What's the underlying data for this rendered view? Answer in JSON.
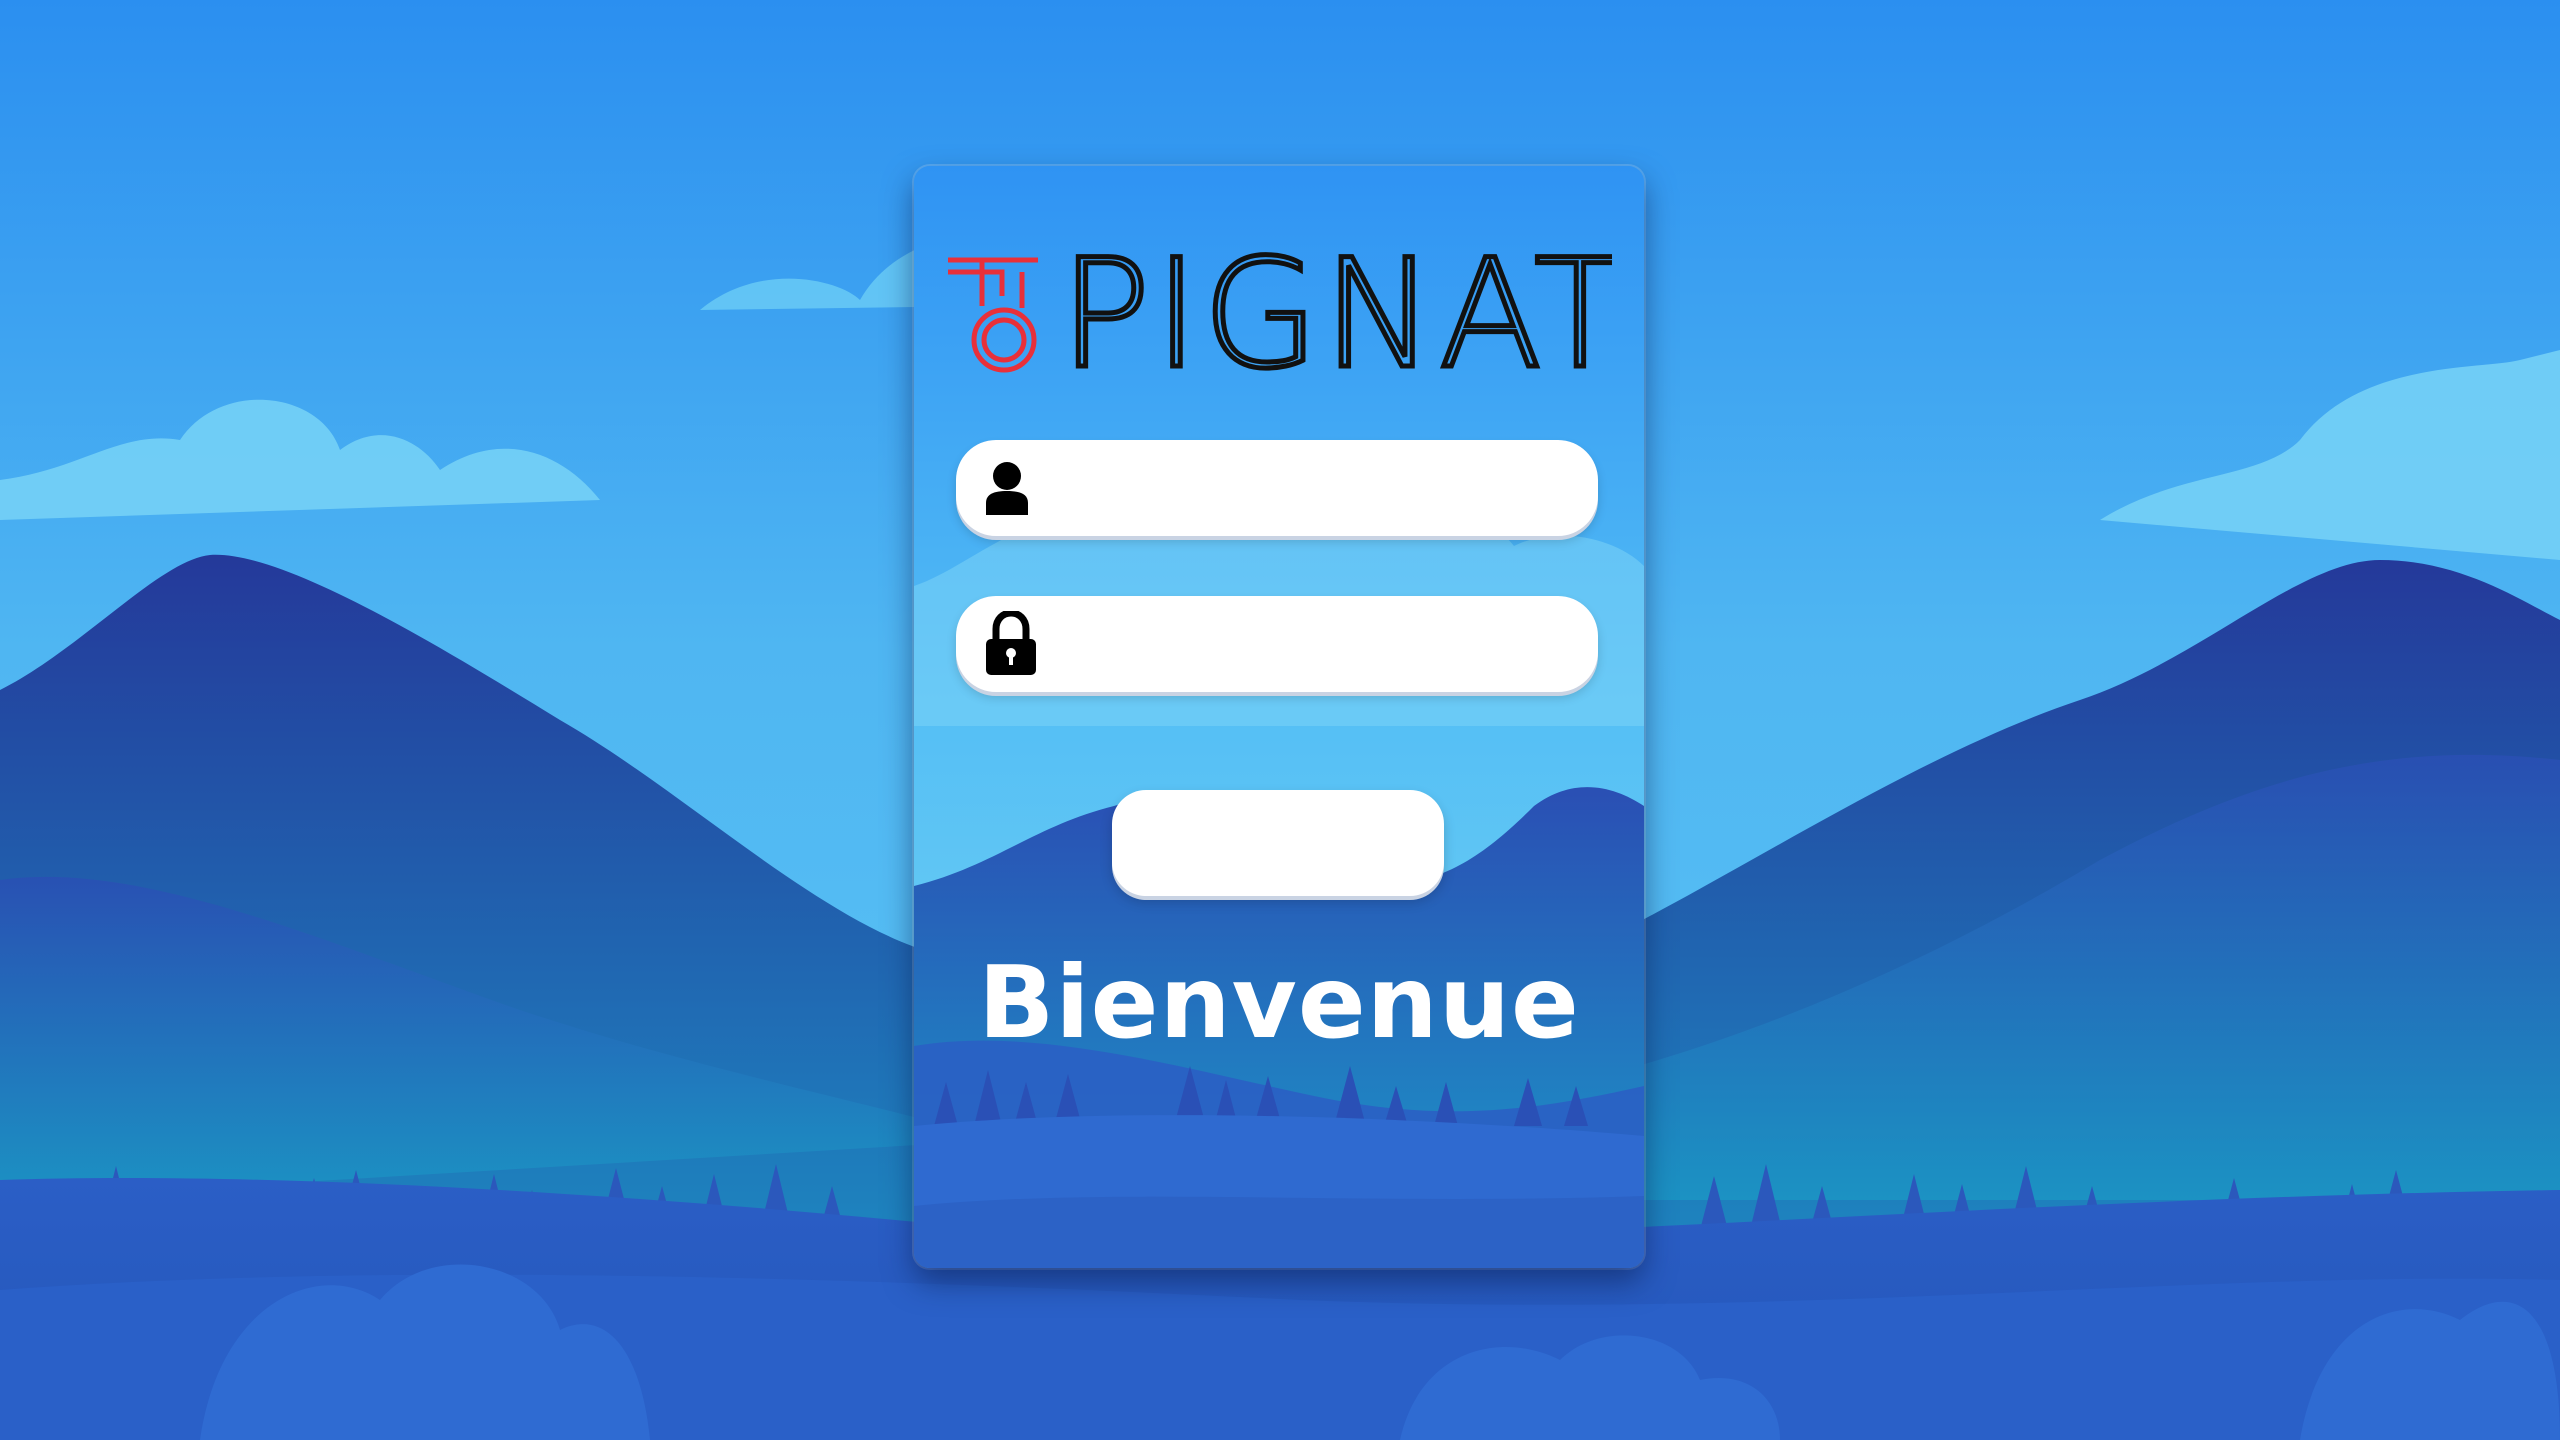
{
  "app": {
    "brand": "PIGNAT",
    "brand_colors": {
      "logo_mark": "#e8303a",
      "logo_text": "#111111"
    }
  },
  "login": {
    "username": {
      "icon": "user-icon",
      "value": "",
      "placeholder": ""
    },
    "password": {
      "icon": "lock-icon",
      "value": "",
      "placeholder": ""
    },
    "submit_label": "",
    "welcome_text": "Bienvenue"
  },
  "theme": {
    "sky_top": "#2b8ff0",
    "sky_bottom": "#5cc6f5",
    "mountain_dark": "#1f3f9e",
    "mountain_mid": "#2a5fc4",
    "ground": "#2f63c9"
  }
}
